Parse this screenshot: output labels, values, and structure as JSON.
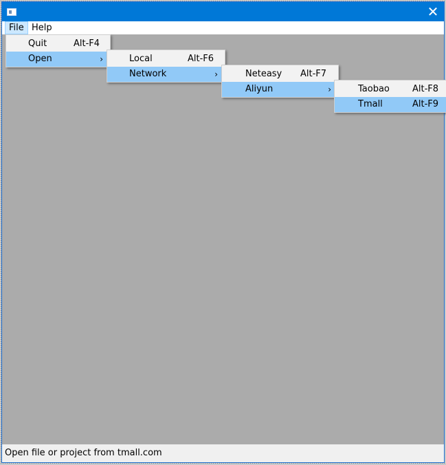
{
  "window": {
    "close_glyph": "✕"
  },
  "menubar": {
    "file": "File",
    "help": "Help"
  },
  "menus": {
    "file": [
      {
        "label": "Quit",
        "shortcut": "Alt-F4"
      },
      {
        "label": "Open",
        "submenu_arrow": "›"
      }
    ],
    "open": [
      {
        "label": "Local",
        "shortcut": "Alt-F6"
      },
      {
        "label": "Network",
        "submenu_arrow": "›"
      }
    ],
    "network": [
      {
        "label": "Neteasy",
        "shortcut": "Alt-F7"
      },
      {
        "label": "Aliyun",
        "submenu_arrow": "›"
      }
    ],
    "aliyun": [
      {
        "label": "Taobao",
        "shortcut": "Alt-F8"
      },
      {
        "label": "Tmall",
        "shortcut": "Alt-F9"
      }
    ]
  },
  "statusbar": {
    "text": "Open file or project from tmall.com"
  },
  "colors": {
    "titlebar": "#0078d7",
    "highlight": "#91c9f7",
    "client_bg": "#ababab"
  }
}
